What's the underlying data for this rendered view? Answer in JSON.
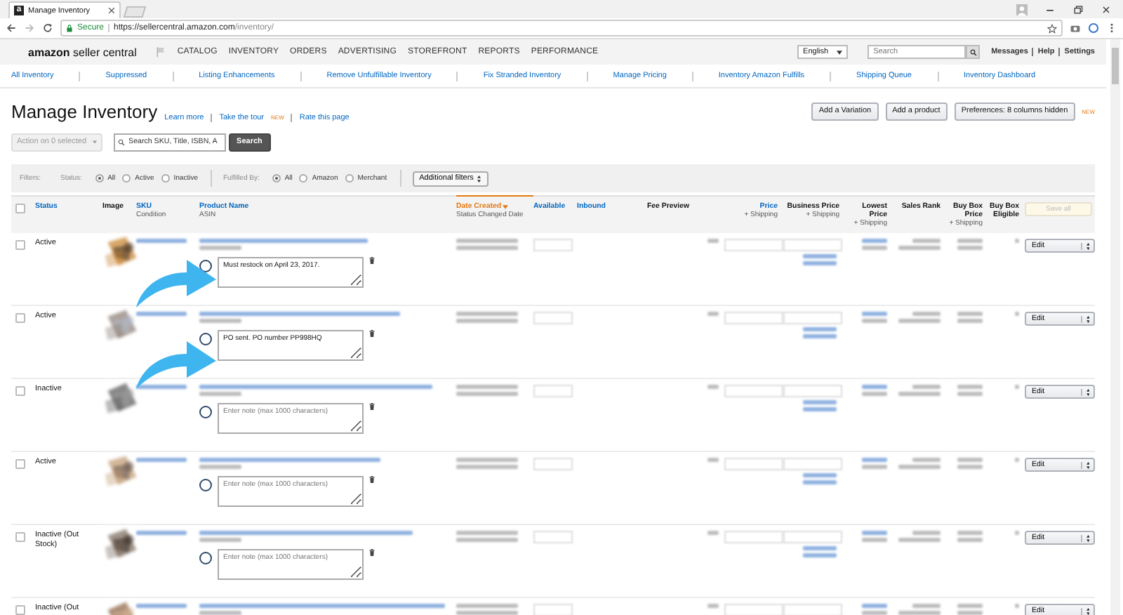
{
  "browser": {
    "tab_title": "Manage Inventory",
    "favicon": "a",
    "secure_label": "Secure",
    "url_host": "https://sellercentral.amazon.com",
    "url_path": "/inventory/"
  },
  "header": {
    "logo_brand": "amazon",
    "logo_product": "seller central",
    "menu": [
      "CATALOG",
      "INVENTORY",
      "ORDERS",
      "ADVERTISING",
      "STOREFRONT",
      "REPORTS",
      "PERFORMANCE"
    ],
    "language": "English",
    "search": {
      "placeholder": "Search"
    },
    "links": [
      "Messages",
      "Help",
      "Settings"
    ]
  },
  "subnav": [
    "All Inventory",
    "Suppressed",
    "Listing Enhancements",
    "Remove Unfulfillable Inventory",
    "Fix Stranded Inventory",
    "Manage Pricing",
    "Inventory Amazon Fulfills",
    "Shipping Queue",
    "Inventory Dashboard"
  ],
  "page": {
    "title": "Manage Inventory",
    "links": [
      {
        "label": "Learn more"
      },
      {
        "label": "Take the tour",
        "badge": "NEW"
      },
      {
        "label": "Rate this page"
      }
    ],
    "buttons": [
      "Add a Variation",
      "Add a product",
      "Preferences: 8 columns hidden"
    ],
    "buttons_badge": "NEW"
  },
  "actions": {
    "bulk": {
      "label": "Action on 0 selected",
      "disabled": true
    },
    "search": {
      "placeholder": "Search SKU, Title, ISBN, A"
    },
    "search_button": "Search"
  },
  "filters": {
    "label": "Filters:",
    "groups": [
      {
        "label": "Status:",
        "options": [
          {
            "label": "All",
            "selected": true
          },
          {
            "label": "Active",
            "selected": false
          },
          {
            "label": "Inactive",
            "selected": false
          }
        ]
      },
      {
        "label": "Fulfilled By:",
        "options": [
          {
            "label": "All",
            "selected": true
          },
          {
            "label": "Amazon",
            "selected": false
          },
          {
            "label": "Merchant",
            "selected": false
          }
        ]
      }
    ],
    "more": "Additional filters"
  },
  "table": {
    "header_checked": false,
    "columns": [
      {
        "label": "Status",
        "link": true,
        "kind": "text"
      },
      {
        "label": "Image",
        "link": false,
        "kind": "text"
      },
      {
        "label": "SKU",
        "sublabel": "Condition",
        "link": true,
        "kind": "text"
      },
      {
        "label": "Product Name",
        "sublabel": "ASIN",
        "link": true,
        "kind": "text"
      },
      {
        "label": "Date Created",
        "sublabel": "Status Changed Date",
        "link": true,
        "sorted": true,
        "kind": "text"
      },
      {
        "label": "Available",
        "link": true,
        "kind": "text"
      },
      {
        "label": "Inbound",
        "link": true,
        "kind": "text"
      },
      {
        "label": "Fee Preview",
        "link": false,
        "kind": "text"
      },
      {
        "label": "Price",
        "sublabel": "+ Shipping",
        "link": true,
        "kind": "number"
      },
      {
        "label": "Business Price",
        "sublabel": "+ Shipping",
        "link": false,
        "kind": "number"
      },
      {
        "label": "Lowest Price",
        "sublabel": "+ Shipping",
        "link": false,
        "kind": "number"
      },
      {
        "label": "Sales Rank",
        "link": false,
        "kind": "number"
      },
      {
        "label": "Buy Box Price",
        "sublabel": "+ Shipping",
        "link": false,
        "kind": "number"
      },
      {
        "label": "Buy Box Eligible",
        "link": false,
        "kind": "number"
      }
    ],
    "save_button": {
      "label": "Save all",
      "disabled": true
    },
    "rows": [
      {
        "checked": false,
        "status": "Active",
        "note": {
          "value": "Must restock on April 23, 2017."
        },
        "action": "Edit"
      },
      {
        "checked": false,
        "status": "Active",
        "note": {
          "value": "PO sent. PO number PP998HQ"
        },
        "action": "Edit"
      },
      {
        "checked": false,
        "status": "Inactive",
        "note": {
          "placeholder": "Enter note (max 1000 characters)"
        },
        "action": "Edit"
      },
      {
        "checked": false,
        "status": "Active",
        "note": {
          "placeholder": "Enter note (max 1000 characters)"
        },
        "action": "Edit"
      },
      {
        "checked": false,
        "status": "Inactive (Out Stock)",
        "note": {
          "placeholder": "Enter note (max 1000 characters)"
        },
        "action": "Edit"
      },
      {
        "checked": false,
        "status": "Inactive (Out",
        "action": "Edit"
      }
    ]
  }
}
